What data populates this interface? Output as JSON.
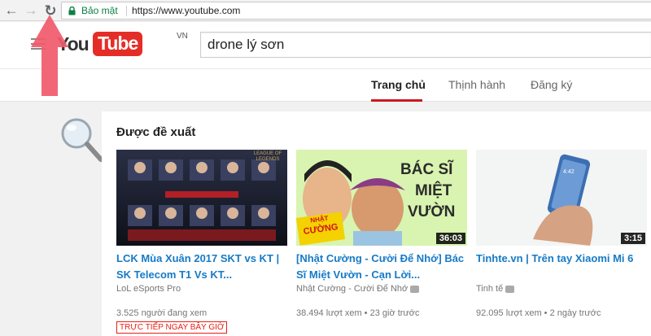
{
  "browser": {
    "back_icon": "arrow-left-icon",
    "forward_icon": "arrow-right-icon",
    "reload_icon": "reload-icon",
    "secure_label": "Bảo mật",
    "url": "https://www.youtube.com"
  },
  "header": {
    "logo_you": "You",
    "logo_tube": "Tube",
    "logo_region": "VN",
    "search_value": "drone lý sơn"
  },
  "tabs": [
    {
      "label": "Trang chủ",
      "active": true
    },
    {
      "label": "Thịnh hành",
      "active": false
    },
    {
      "label": "Đăng ký",
      "active": false
    }
  ],
  "section": {
    "title": "Được đề xuất"
  },
  "videos": [
    {
      "title": "LCK Mùa Xuân 2017 SKT vs KT | SK Telecom T1 Vs KT...",
      "channel": "LoL eSports Pro",
      "views": "3.525 người đang xem",
      "badge": "TRỰC TIẾP NGAY BÂY GIỜ",
      "thumb_text": "LEAGUE OF LEGENDS"
    },
    {
      "title": "[Nhật Cường - Cười Để Nhớ] Bác Sĩ Miệt Vườn - Cạn Lời...",
      "channel": "Nhật Cường - Cười Để Nhớ",
      "views": "38.494 lượt xem",
      "age": "23 giờ trước",
      "duration": "36:03",
      "thumb_line1": "BÁC SĨ",
      "thumb_line2": "MIỆT",
      "thumb_line3": "VƯỜN",
      "thumb_badge_top": "NHẬT",
      "thumb_badge_bottom": "CƯỜNG"
    },
    {
      "title": "Tinhte.vn | Trên tay Xiaomi Mi 6",
      "channel": "Tinh tế",
      "views": "92.095 lượt xem",
      "age": "2 ngày trước",
      "duration": "3:15",
      "phone_time": "4:42"
    }
  ],
  "colors": {
    "accent_red": "#cc181e",
    "link_blue": "#167ac6",
    "secure_green": "#0b8043"
  }
}
